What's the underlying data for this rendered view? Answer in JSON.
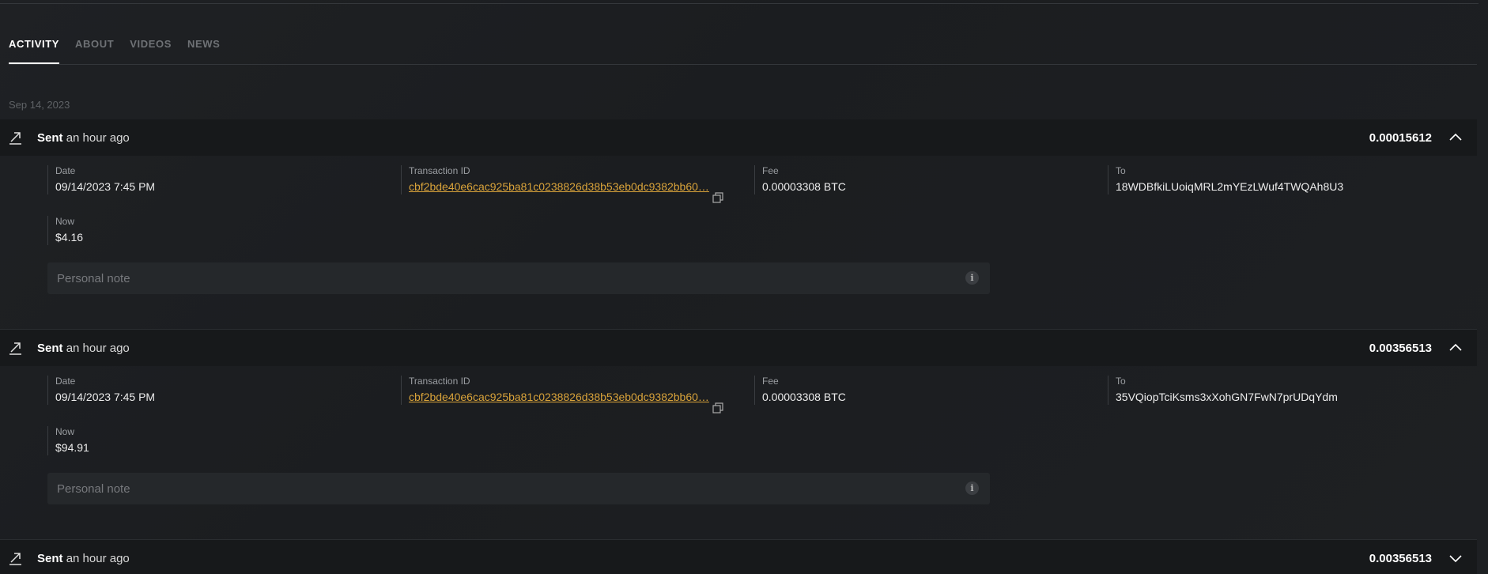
{
  "tabs": [
    {
      "label": "ACTIVITY",
      "active": true
    },
    {
      "label": "ABOUT",
      "active": false
    },
    {
      "label": "VIDEOS",
      "active": false
    },
    {
      "label": "NEWS",
      "active": false
    }
  ],
  "date_group": "Sep 14, 2023",
  "labels": {
    "date": "Date",
    "transaction_id": "Transaction ID",
    "fee": "Fee",
    "to": "To",
    "now": "Now",
    "note_placeholder": "Personal note"
  },
  "transactions": [
    {
      "type": "Sent",
      "time": "an hour ago",
      "amount": "0.00015612",
      "expanded": true,
      "date": "09/14/2023 7:45 PM",
      "tx_id": "cbf2bde40e6cac925ba81c0238826d38b53eb0dc9382bb60…",
      "fee": "0.00003308 BTC",
      "to": "18WDBfkiLUoiqMRL2mYEzLWuf4TWQAh8U3",
      "now": "$4.16"
    },
    {
      "type": "Sent",
      "time": "an hour ago",
      "amount": "0.00356513",
      "expanded": true,
      "date": "09/14/2023 7:45 PM",
      "tx_id": "cbf2bde40e6cac925ba81c0238826d38b53eb0dc9382bb60…",
      "fee": "0.00003308 BTC",
      "to": "35VQiopTciKsms3xXohGN7FwN7prUDqYdm",
      "now": "$94.91"
    },
    {
      "type": "Sent",
      "time": "an hour ago",
      "amount": "0.00356513",
      "expanded": false
    }
  ],
  "colors": {
    "background": "#1c1e21",
    "row_header": "#17191b",
    "link": "#d9a33a",
    "label": "#9b9ea2"
  }
}
